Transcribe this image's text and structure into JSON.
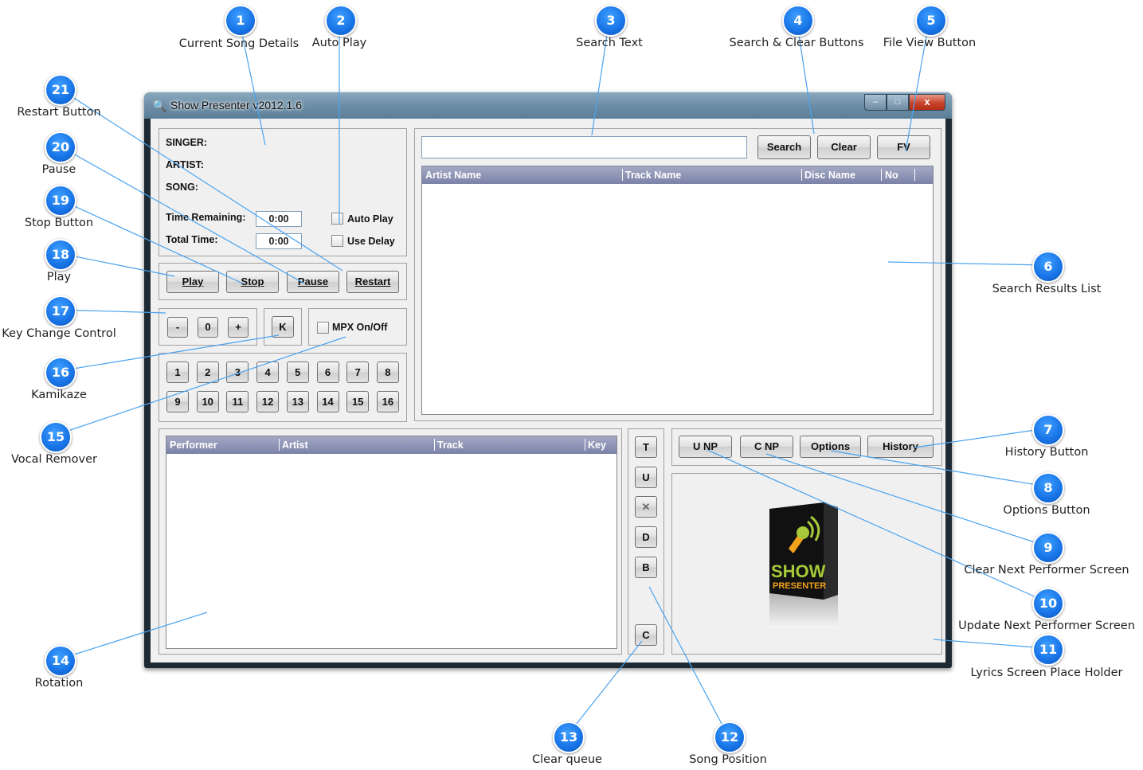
{
  "window": {
    "title": "Show Presenter v2012.1.6",
    "min": "–",
    "max": "□",
    "close": "x"
  },
  "details": {
    "singer_label": "SINGER:",
    "artist_label": "ARTIST:",
    "song_label": "SONG:",
    "time_remaining_label": "Time Remaining:",
    "time_remaining_value": "0:00",
    "total_time_label": "Total Time:",
    "total_time_value": "0:00",
    "auto_play_label": "Auto Play",
    "use_delay_label": "Use Delay"
  },
  "transport": {
    "play": "Play",
    "stop": "Stop",
    "pause": "Pause",
    "restart": "Restart"
  },
  "key": {
    "minus": "-",
    "zero": "0",
    "plus": "+",
    "kamikaze": "K",
    "mpx_label": "MPX On/Off"
  },
  "presets": [
    "1",
    "2",
    "3",
    "4",
    "5",
    "6",
    "7",
    "8",
    "9",
    "10",
    "11",
    "12",
    "13",
    "14",
    "15",
    "16"
  ],
  "search": {
    "value": "",
    "search_button": "Search",
    "clear_button": "Clear",
    "fv_button": "FV",
    "columns": [
      "Artist Name",
      "Track Name",
      "Disc Name",
      "No"
    ]
  },
  "rotation": {
    "columns": [
      "Performer",
      "Artist",
      "Track",
      "Key"
    ]
  },
  "position_buttons": {
    "top": "T",
    "up": "U",
    "delete": "✕",
    "down": "D",
    "bottom": "B",
    "clear": "C"
  },
  "next_performer": {
    "unp": "U NP",
    "cnp": "C NP",
    "options": "Options",
    "history": "History"
  },
  "logo": {
    "line1": "SHOW",
    "line2": "PRESENTER"
  },
  "callouts": [
    {
      "n": "1",
      "label": "Current Song Details"
    },
    {
      "n": "2",
      "label": "Auto Play"
    },
    {
      "n": "3",
      "label": "Search Text"
    },
    {
      "n": "4",
      "label": "Search & Clear Buttons"
    },
    {
      "n": "5",
      "label": "File View Button"
    },
    {
      "n": "6",
      "label": "Search Results List"
    },
    {
      "n": "7",
      "label": "History Button"
    },
    {
      "n": "8",
      "label": "Options Button"
    },
    {
      "n": "9",
      "label": "Clear Next Performer Screen"
    },
    {
      "n": "10",
      "label": "Update Next Performer Screen"
    },
    {
      "n": "11",
      "label": "Lyrics Screen Place Holder"
    },
    {
      "n": "12",
      "label": "Song Position"
    },
    {
      "n": "13",
      "label": "Clear queue"
    },
    {
      "n": "14",
      "label": "Rotation"
    },
    {
      "n": "15",
      "label": "Vocal Remover"
    },
    {
      "n": "16",
      "label": "Kamikaze"
    },
    {
      "n": "17",
      "label": "Key Change Control"
    },
    {
      "n": "18",
      "label": "Play"
    },
    {
      "n": "19",
      "label": "Stop Button"
    },
    {
      "n": "20",
      "label": "Pause"
    },
    {
      "n": "21",
      "label": "Restart Button"
    }
  ],
  "colors": {
    "badge": "#1773e6",
    "leader": "#4aa3f0",
    "list_header": "#8a90b3"
  }
}
